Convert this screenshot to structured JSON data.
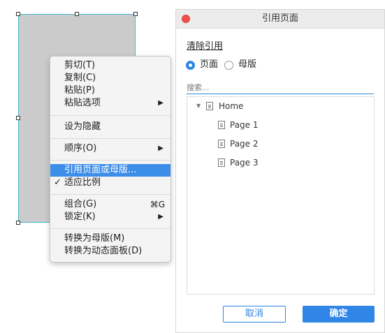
{
  "context_menu": {
    "cut": "剪切(T)",
    "copy": "复制(C)",
    "paste": "粘贴(P)",
    "paste_options": "粘贴选项",
    "hide": "设为隐藏",
    "order": "顺序(O)",
    "reference": "引用页面或母版...",
    "fit": "适应比例",
    "group": "组合(G)",
    "group_shortcut": "⌘G",
    "lock": "锁定(K)",
    "to_master": "转换为母版(M)",
    "to_dynamic_panel": "转换为动态面板(D)",
    "submenu_arrow": "▶",
    "checkmark": "✓"
  },
  "dialog": {
    "title": "引用页面",
    "clear_link": "清除引用",
    "radio_page": "页面",
    "radio_master": "母版",
    "selected_radio": "页面",
    "search_placeholder": "搜索...",
    "tree": {
      "root": "Home",
      "children": [
        "Page 1",
        "Page 2",
        "Page 3"
      ]
    },
    "cancel": "取消",
    "ok": "确定"
  },
  "colors": {
    "accent": "#2f86e6",
    "menu_highlight": "#3d8ee8",
    "close_button": "#f0514d",
    "shape_fill": "#cbcbcb",
    "selection_border": "#3fb6d2"
  }
}
